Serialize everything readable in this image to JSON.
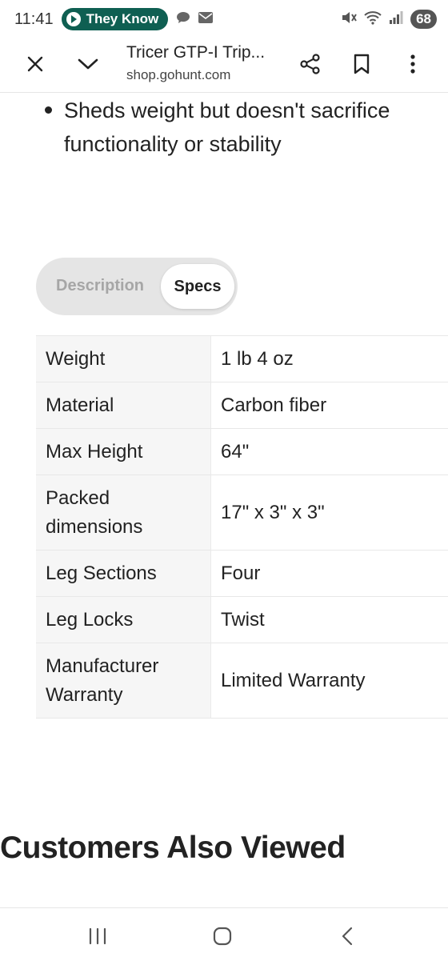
{
  "status_bar": {
    "time": "11:41",
    "notification_label": "They Know",
    "battery": "68"
  },
  "browser": {
    "title": "Tricer GTP-I Trip...",
    "url": "shop.gohunt.com"
  },
  "content": {
    "bullet_text": "Sheds weight but doesn't sacrifice functionality or stability",
    "tabs": [
      "Description",
      "Specs"
    ],
    "active_tab": "Specs",
    "specs": [
      {
        "label": "Weight",
        "value": "1 lb 4 oz"
      },
      {
        "label": "Material",
        "value": "Carbon fiber"
      },
      {
        "label": "Max Height",
        "value": "64\""
      },
      {
        "label": "Packed dimensions",
        "value": "17\" x 3\" x 3\""
      },
      {
        "label": "Leg Sections",
        "value": "Four"
      },
      {
        "label": "Leg Locks",
        "value": "Twist"
      },
      {
        "label": "Manufacturer Warranty",
        "value": "Limited Warranty"
      }
    ],
    "section_title": "Customers Also Viewed"
  },
  "colors": {
    "notification_pill": "#0f5f52",
    "tab_track": "#e5e5e5",
    "spec_label_bg": "#f6f6f6"
  },
  "icons": [
    "play-icon",
    "chat-icon",
    "mail-icon",
    "mute-icon",
    "wifi-icon",
    "signal-icon",
    "close-icon",
    "chevron-down-icon",
    "share-icon",
    "bookmark-icon",
    "more-vert-icon",
    "recents-icon",
    "home-icon",
    "back-icon"
  ]
}
